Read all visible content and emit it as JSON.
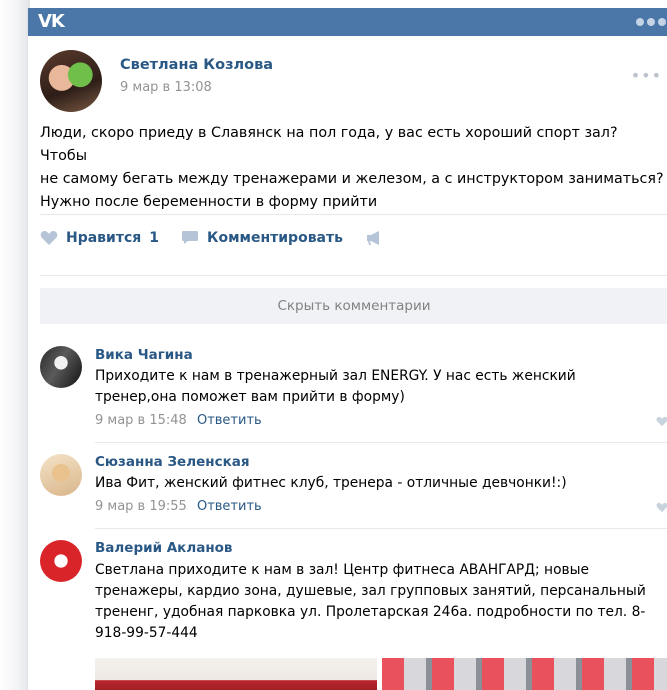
{
  "app": {
    "logo": "VK"
  },
  "post": {
    "author": "Светлана Козлова",
    "date": "9 мар в 13:08",
    "text_lines": [
      "Люди, скоро приеду в Славянск на пол года, у вас есть хороший спорт зал? Чтобы",
      "не самому бегать между тренажерами и железом, а с инструктором заниматься?",
      "Нужно после беременности в форму прийти"
    ],
    "like_label": "Нравится",
    "like_count": "1",
    "comment_label": "Комментировать"
  },
  "hide_comments_label": "Скрыть комментарии",
  "comments": [
    {
      "name": "Вика Чагина",
      "lines": [
        "Приходите к нам в тренажерный зал ENERGY. У нас есть женский",
        "тренер,она поможет вам прийти в форму)"
      ],
      "date": "9 мар в 15:48",
      "reply": "Ответить"
    },
    {
      "name": "Сюзанна Зеленская",
      "lines": [
        "Ива Фит, женский фитнес клуб, тренера - отличные девчонки!:)"
      ],
      "date": "9 мар в 19:55",
      "reply": "Ответить"
    },
    {
      "name": "Валерий Акланов",
      "lines": [
        "Светлана приходите к нам в зал! Центр фитнеса АВАНГАРД; новые",
        "тренажеры, кардио зона, душевые, зал групповых занятий, персанальный",
        "тренeнг, удобная парковка ул. Пролетарская 246а. подробности по тел. 8-",
        "918-99-57-444"
      ]
    }
  ],
  "icons": {
    "like": "heart-icon",
    "comment": "speech-bubble-icon",
    "share": "megaphone-icon"
  },
  "colors": {
    "header": "#4a76a8",
    "link": "#2a5885",
    "muted": "#939393",
    "icon": "#b5c4d7"
  }
}
